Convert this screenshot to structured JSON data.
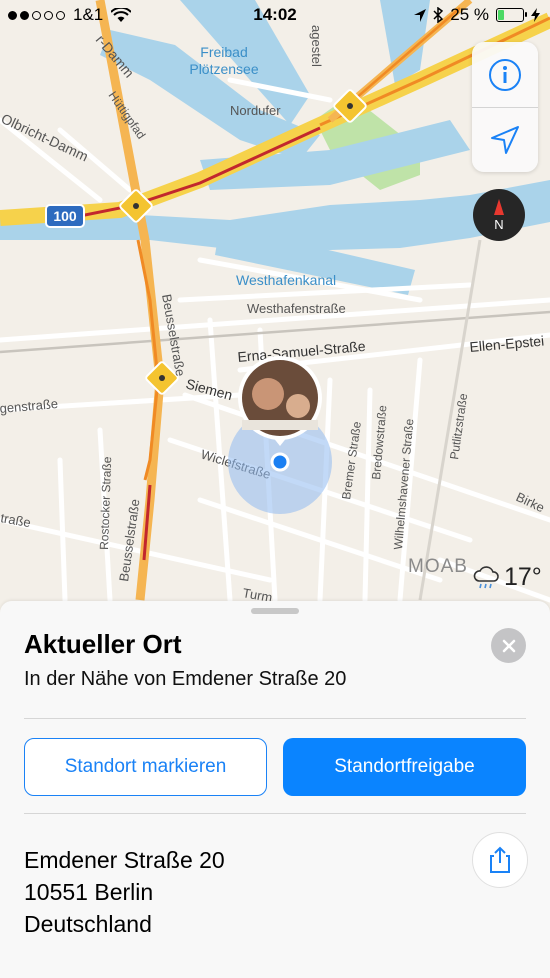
{
  "status_bar": {
    "carrier": "1&1",
    "time": "14:02",
    "battery": "25 %",
    "battery_level": 0.25,
    "signal_bars": 2
  },
  "map": {
    "labels": {
      "freibad_1": "Freibad",
      "freibad_2": "Plötzensee",
      "nordufer": "Nordufer",
      "huettigpfad": "Hüttigpfad",
      "olbricht": "Olbricht-Damm",
      "damm": "r-Damm",
      "westhafenkanal": "Westhafenkanal",
      "westhafenstrasse": "Westhafenstraße",
      "erna": "Erna-Samuel-Straße",
      "ellen": "Ellen-Epstei",
      "siemens": "Siemen",
      "genstrasse": "genstraße",
      "wiclef": "Wiclefstraße",
      "beussel_top": "Beusselstraße",
      "beussel_bottom": "Beusselstraße",
      "rostocker": "Rostocker Straße",
      "bremer": "Bremer Straße",
      "bredow": "Bredowstraße",
      "wilhelmshaven": "Wilhelmshavener Straße",
      "putlitz": "Putlitzstraße",
      "birken": "Birke",
      "strasse_left": "traße",
      "turm": "Turm",
      "moab": "MOAB",
      "ageste": "agestel",
      "highway_shield": "100"
    }
  },
  "controls": {
    "info_icon": "info-icon",
    "location_icon": "location-arrow-icon",
    "compass_letter": "N"
  },
  "weather": {
    "temperature": "17°"
  },
  "sheet": {
    "title": "Aktueller Ort",
    "subtitle": "In der Nähe von Emdener Straße 20",
    "mark_button": "Standort markieren",
    "share_location_button": "Standortfreigabe",
    "address_line1": "Emdener Straße 20",
    "address_line2": "10551 Berlin",
    "address_line3": "Deutschland"
  },
  "colors": {
    "accent": "#0a84ff",
    "water": "#aad3ea",
    "highway": "#f6d24b",
    "traffic_heavy": "#c2272d",
    "park": "#b8e0a0"
  }
}
